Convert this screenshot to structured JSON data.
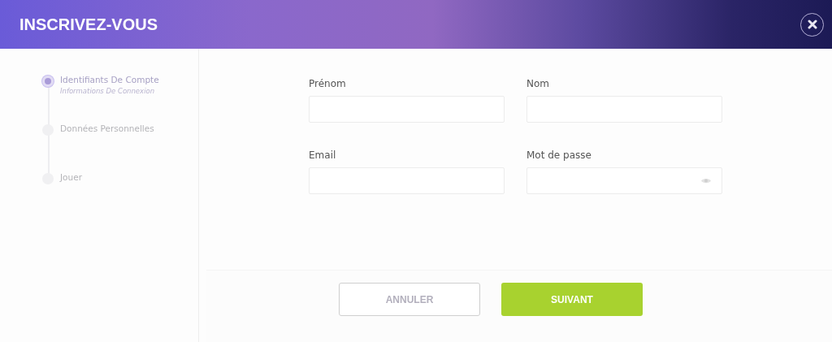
{
  "window": {
    "title": "INSCRIVEZ-VOUS"
  },
  "steps": [
    {
      "label": "Identifiants De Compte",
      "subtitle": "Informations De Connexion",
      "selected": true
    },
    {
      "label": "Données Personnelles",
      "selected": false
    },
    {
      "label": "Jouer",
      "selected": false
    }
  ],
  "fields": [
    {
      "label": "Prénom",
      "kind": "text"
    },
    {
      "label": "Nom",
      "kind": "text"
    },
    {
      "label": "Email",
      "kind": "text"
    },
    {
      "label": "Mot de passe",
      "kind": "password"
    }
  ],
  "buttons": [
    {
      "label": "ANNULER",
      "kind": "secondary"
    },
    {
      "label": "SUIVANT",
      "kind": "primary"
    }
  ]
}
